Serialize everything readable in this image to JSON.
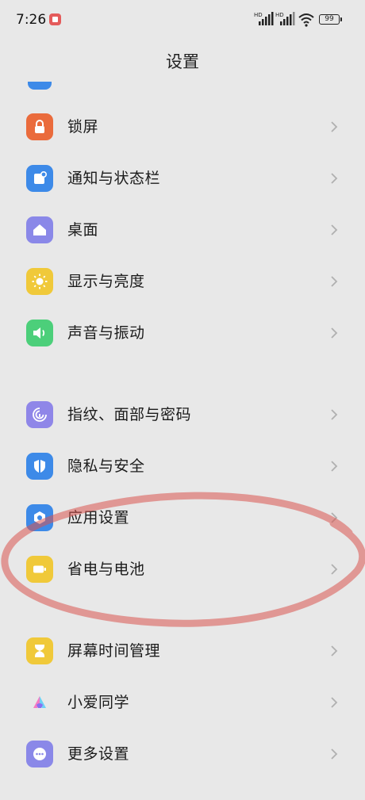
{
  "status_bar": {
    "time": "7:26",
    "sig1_label": "HD",
    "sig2_label": "HD",
    "battery": "99"
  },
  "header": {
    "title": "设置"
  },
  "settings": {
    "lock_screen": "锁屏",
    "notifications": "通知与状态栏",
    "desktop": "桌面",
    "display": "显示与亮度",
    "sound": "声音与振动",
    "fingerprint": "指纹、面部与密码",
    "privacy": "隐私与安全",
    "apps": "应用设置",
    "battery": "省电与电池",
    "screen_time": "屏幕时间管理",
    "xiaoai": "小爱同学",
    "more": "更多设置"
  },
  "colors": {
    "background": "#e8e8e8",
    "lock_icon": "#ea6b3c",
    "notification_icon": "#3d8ae8",
    "desktop_icon": "#8a88e8",
    "display_icon": "#f0c93a",
    "sound_icon": "#4ccf7a",
    "fingerprint_icon": "#8f86e8",
    "privacy_icon": "#3d8ae8",
    "apps_icon": "#3d8ae8",
    "battery_icon": "#f0c93a",
    "screen_time_icon": "#f0c93a",
    "more_icon": "#8a88e8",
    "annotation": "#d9534f"
  }
}
